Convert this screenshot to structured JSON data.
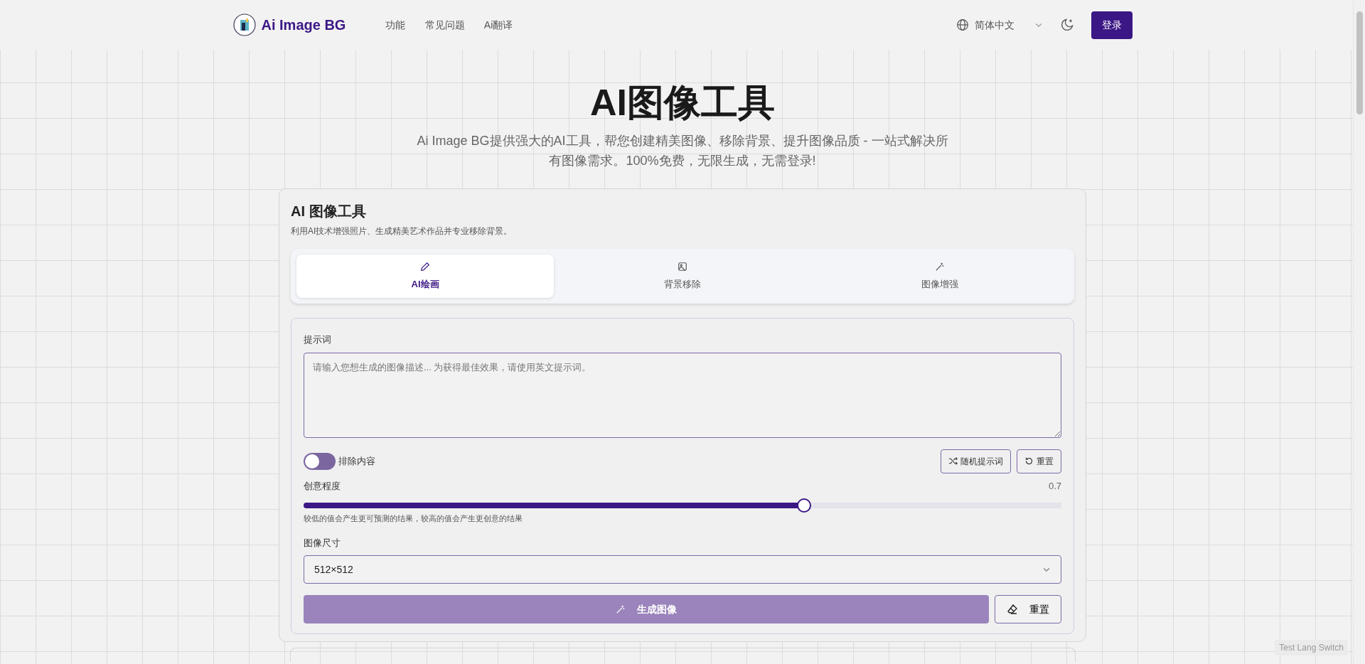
{
  "navbar": {
    "brand": "Ai Image BG",
    "links": [
      {
        "label": "功能"
      },
      {
        "label": "常见问题"
      },
      {
        "label": "Ai翻译"
      }
    ],
    "language": "简体中文",
    "login": "登录"
  },
  "hero": {
    "title": "AI图像工具",
    "subtitle": "Ai Image BG提供强大的AI工具，帮您创建精美图像、移除背景、提升图像品质 - 一站式解决所有图像需求。100%免费，无限生成，无需登录!"
  },
  "tool": {
    "title": "AI 图像工具",
    "description": "利用AI技术增强照片、生成精美艺术作品并专业移除背景。",
    "tabs": [
      {
        "label": "AI绘画",
        "kind": "pencil",
        "selected": true
      },
      {
        "label": "背景移除",
        "kind": "image",
        "selected": false
      },
      {
        "label": "图像增强",
        "kind": "wand",
        "selected": false
      }
    ],
    "prompt": {
      "label": "提示词",
      "placeholder": "请输入您想生成的图像描述... 为获得最佳效果，请使用英文提示词。"
    },
    "exclude": {
      "label": "排除内容",
      "on": false
    },
    "prompt_buttons": [
      {
        "label": "随机提示词",
        "kind": "shuffle"
      },
      {
        "label": "重置",
        "kind": "reset"
      }
    ],
    "creativity": {
      "label": "创意程度",
      "reading": "0.7",
      "level": 0.66,
      "hint": "较低的值会产生更可预测的结果，较高的值会产生更创意的结果"
    },
    "size": {
      "label": "图像尺寸",
      "value": "512×512"
    },
    "generate": {
      "label": "生成图像",
      "disabled": true
    },
    "reset": {
      "label": "重置"
    }
  },
  "floating_badge": "Test Lang Switch"
}
